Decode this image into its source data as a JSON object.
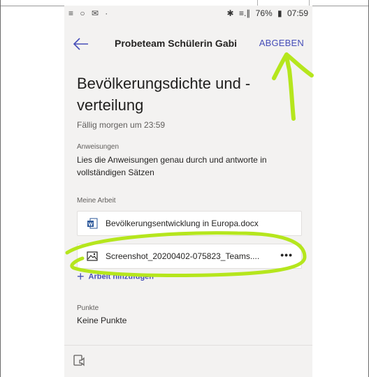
{
  "statusbar": {
    "left_icons": "≡ ○ ✉ ·",
    "bluetooth_icon": "✱",
    "signal_icon": "≡.∥",
    "battery_percent": "76%",
    "time": "07:59"
  },
  "appbar": {
    "title": "Probeteam Schülerin Gabi",
    "submit_label": "ABGEBEN"
  },
  "assignment": {
    "title": "Bevölkerungsdichte und - verteilung",
    "due": "Fällig morgen um 23:59",
    "instructions_label": "Anweisungen",
    "instructions_text": "Lies die Anweisungen genau durch und antworte in vollständigen Sätzen",
    "my_work_label": "Meine Arbeit",
    "files": [
      {
        "name": "Bevölkerungsentwicklung in Europa.docx",
        "icon": "word-doc-icon"
      },
      {
        "name": "Screenshot_20200402-075823_Teams....",
        "icon": "image-file-icon"
      }
    ],
    "add_work_label": "Arbeit hinzufügen",
    "points_label": "Punkte",
    "points_value": "Keine Punkte"
  },
  "colors": {
    "accent": "#464eb8",
    "annotation": "#b5e61d",
    "background": "#f3f2f1"
  }
}
